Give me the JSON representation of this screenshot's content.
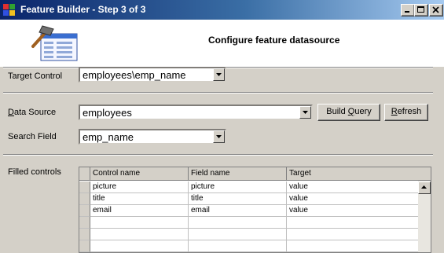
{
  "window": {
    "title": "Feature Builder - Step 3 of 3",
    "buttons": {
      "minimize": "minimize-icon",
      "maximize": "maximize-icon",
      "close": "close-icon"
    }
  },
  "header": {
    "title": "Configure feature datasource",
    "art_icon": "wizard-hammer-form-icon"
  },
  "form": {
    "target_control": {
      "label": "Target Control",
      "value": "employees\\emp_name"
    },
    "data_source": {
      "label_accel": "D",
      "label_rest": "ata Source",
      "value": "employees"
    },
    "search_field": {
      "label": "Search Field",
      "value": "emp_name"
    },
    "build_query_label_pre": "Build ",
    "build_query_label_accel": "Q",
    "build_query_label_post": "uery",
    "refresh_label_accel": "R",
    "refresh_label_rest": "efresh"
  },
  "filled_controls": {
    "label": "Filled controls",
    "columns": [
      "Control name",
      "Field name",
      "Target"
    ],
    "rows": [
      [
        "picture",
        "picture",
        "value"
      ],
      [
        "title",
        "title",
        "value"
      ],
      [
        "email",
        "email",
        "value"
      ],
      [
        "",
        "",
        ""
      ],
      [
        "",
        "",
        ""
      ],
      [
        "",
        "",
        ""
      ]
    ]
  },
  "colors": {
    "titlebar_start": "#0a246a",
    "titlebar_end": "#a6caf0",
    "face": "#d4d0c8"
  }
}
